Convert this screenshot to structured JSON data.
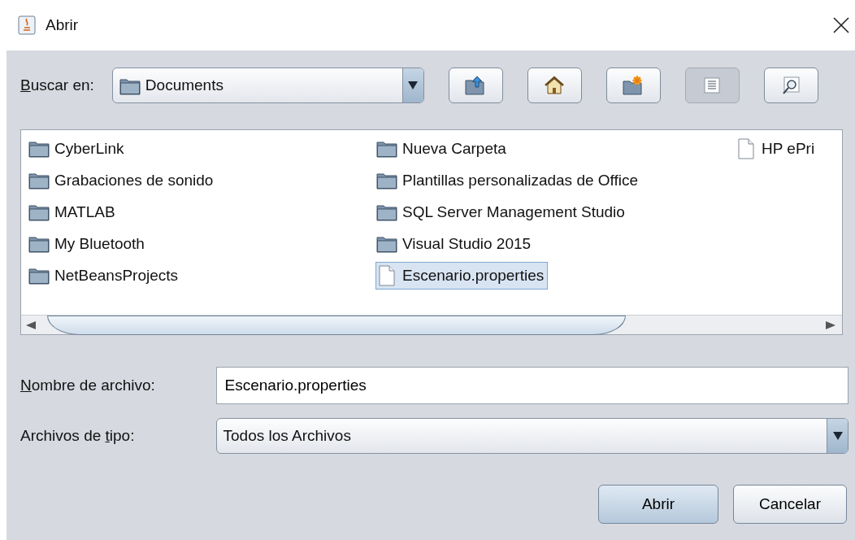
{
  "window": {
    "title": "Abrir"
  },
  "look_in": {
    "label_parts": [
      {
        "text": "B",
        "underlined": true
      },
      {
        "text": "uscar en:",
        "underlined": false
      }
    ],
    "value": "Documents"
  },
  "toolbar": [
    {
      "kind": "up-folder",
      "selected": false
    },
    {
      "kind": "home",
      "selected": false
    },
    {
      "kind": "new-folder",
      "selected": false
    },
    {
      "kind": "list-view",
      "selected": true
    },
    {
      "kind": "details-view",
      "selected": false
    }
  ],
  "file_columns": [
    {
      "items": [
        {
          "name": "CyberLink",
          "kind": "folder",
          "selected": false
        },
        {
          "name": "Grabaciones de sonido",
          "kind": "folder",
          "selected": false
        },
        {
          "name": "MATLAB",
          "kind": "folder",
          "selected": false
        },
        {
          "name": "My Bluetooth",
          "kind": "folder",
          "selected": false
        },
        {
          "name": "NetBeansProjects",
          "kind": "folder",
          "selected": false
        }
      ]
    },
    {
      "items": [
        {
          "name": "Nueva Carpeta",
          "kind": "folder",
          "selected": false
        },
        {
          "name": "Plantillas personalizadas de Office",
          "kind": "folder",
          "selected": false
        },
        {
          "name": "SQL Server Management Studio",
          "kind": "folder",
          "selected": false
        },
        {
          "name": "Visual Studio 2015",
          "kind": "folder",
          "selected": false
        },
        {
          "name": "Escenario.properties",
          "kind": "file",
          "selected": true
        }
      ]
    },
    {
      "items": [
        {
          "name": "HP ePri",
          "kind": "file",
          "selected": false
        }
      ]
    }
  ],
  "file_name": {
    "label_parts": [
      {
        "text": "N",
        "underlined": true
      },
      {
        "text": "ombre de archivo:",
        "underlined": false
      }
    ],
    "value": "Escenario.properties"
  },
  "file_type": {
    "label_parts": [
      {
        "text": "Archivos de ",
        "underlined": false
      },
      {
        "text": "t",
        "underlined": true
      },
      {
        "text": "ipo:",
        "underlined": false
      }
    ],
    "value": "Todos los Archivos"
  },
  "buttons": [
    {
      "label": "Abrir",
      "kind": "default"
    },
    {
      "label": "Cancelar",
      "kind": "normal"
    }
  ]
}
